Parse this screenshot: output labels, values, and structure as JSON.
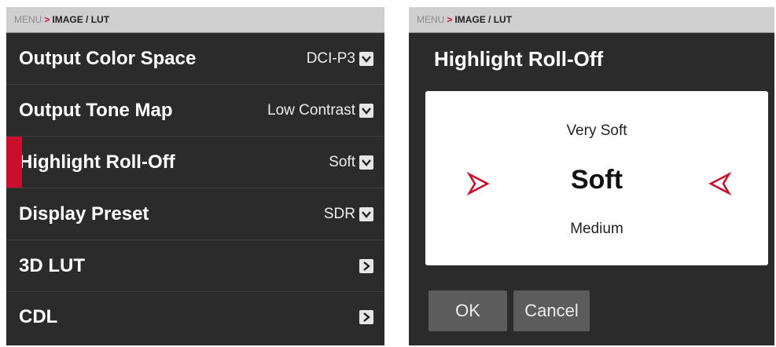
{
  "left": {
    "breadcrumb": {
      "root": "MENU",
      "separator": ">",
      "path": "IMAGE / LUT"
    },
    "rows": [
      {
        "label": "Output Color Space",
        "value": "DCI-P3"
      },
      {
        "label": "Output Tone Map",
        "value": "Low Contrast"
      },
      {
        "label": "Highlight Roll-Off",
        "value": "Soft"
      },
      {
        "label": "Display Preset",
        "value": "SDR"
      },
      {
        "label": "3D LUT"
      },
      {
        "label": "CDL"
      }
    ]
  },
  "right": {
    "breadcrumb": {
      "root": "MENU",
      "separator": ">",
      "path": "IMAGE / LUT"
    },
    "title": "Highlight Roll-Off",
    "picker": {
      "above": "Very Soft",
      "current": "Soft",
      "below": "Medium"
    },
    "ok_label": "OK",
    "cancel_label": "Cancel"
  },
  "colors": {
    "accent": "#c8102e",
    "panel_bg": "#2b2b2b",
    "breadcrumb_bg": "#cfcfcf",
    "button_bg": "#5c5c5c"
  },
  "icons": {
    "dropdown": "chevron-down-icon",
    "submenu": "chevron-right-icon",
    "picker_prev": "arrow-right-outline-icon",
    "picker_next": "arrow-left-outline-icon"
  }
}
